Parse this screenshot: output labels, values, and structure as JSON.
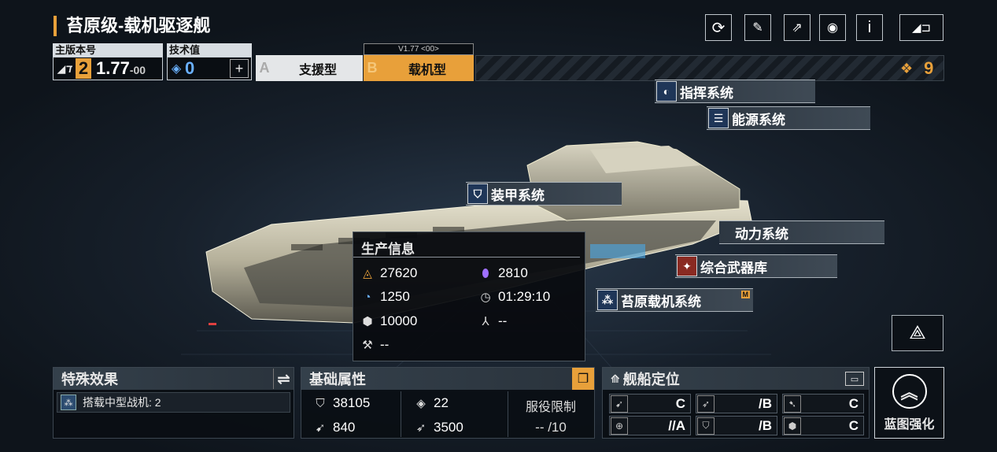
{
  "header": {
    "title": "苔原级-载机驱逐舰"
  },
  "toolbar": {
    "icons": [
      "refresh-icon",
      "paint-icon",
      "share-icon",
      "view-icon",
      "info-icon",
      "exit-icon"
    ],
    "info_label": "i"
  },
  "version": {
    "main_label": "主版本号",
    "main_num": "2",
    "main_version": "1.77",
    "main_suffix": "-00",
    "tech_label": "技术值",
    "tech_value": "0",
    "add_symbol": "+"
  },
  "tabs": {
    "a_letter": "A",
    "a_label": "支援型",
    "b_letter": "B",
    "b_label": "载机型",
    "b_version": "V1.77 <00>"
  },
  "currency": {
    "value": "9"
  },
  "systems": {
    "command": "指挥系统",
    "energy": "能源系统",
    "armor": "装甲系统",
    "power": "动力系统",
    "weapons": "综合武器库",
    "carrier": "苔原载机系统",
    "carrier_badge": "M"
  },
  "production": {
    "title": "生产信息",
    "metal": "27620",
    "crystal": "2810",
    "deuterium": "1250",
    "time": "01:29:10",
    "cube": "10000",
    "triple": "--",
    "hammer": "--"
  },
  "special": {
    "title": "特殊效果",
    "swap": "⇌",
    "effect": "搭载中型战机: 2"
  },
  "base": {
    "title": "基础属性",
    "hp": "38105",
    "armor": "22",
    "attack": "840",
    "speed": "3500",
    "limit_label": "服役限制",
    "limit_value": "-- /10"
  },
  "position": {
    "title": "舰船定位",
    "ratings": [
      "C",
      "/B",
      "C",
      "//A",
      "/B",
      "C"
    ]
  },
  "upgrade": {
    "label": "蓝图强化"
  },
  "colors": {
    "accent": "#e8a03a",
    "tab_active": "#e8a03a",
    "panel": "#0a0e13"
  }
}
